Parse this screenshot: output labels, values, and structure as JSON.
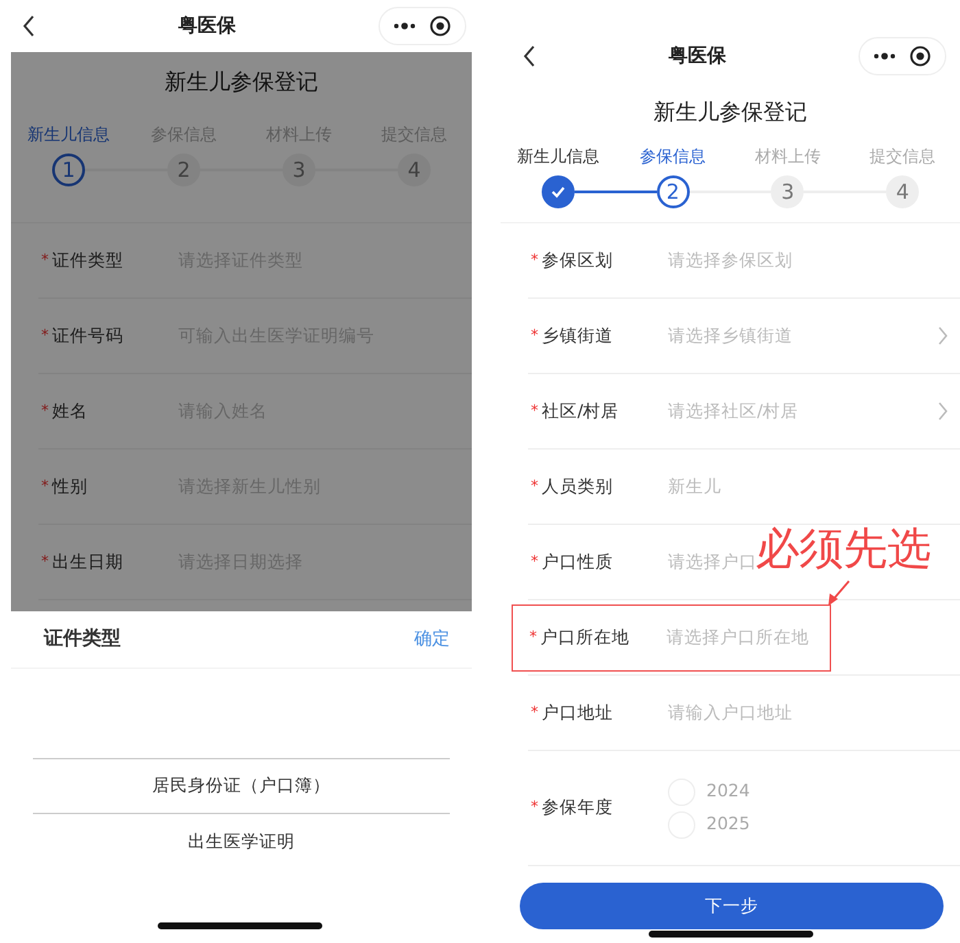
{
  "screens": [
    {
      "nav": {
        "title": "粤医保"
      },
      "page_title": "新生儿参保登记",
      "steps": [
        {
          "label": "新生儿信息",
          "number": "1",
          "completed": false,
          "current": true
        },
        {
          "label": "参保信息",
          "number": "2",
          "completed": false,
          "current": false
        },
        {
          "label": "材料上传",
          "number": "3",
          "completed": false,
          "current": false
        },
        {
          "label": "提交信息",
          "number": "4",
          "completed": false,
          "current": false
        }
      ],
      "fields": [
        {
          "kind": "text",
          "required_mark": "*",
          "label": "证件类型",
          "placeholder": "请选择证件类型"
        },
        {
          "kind": "text",
          "required_mark": "*",
          "label": "证件号码",
          "placeholder": "可输入出生医学证明编号"
        },
        {
          "kind": "text",
          "required_mark": "*",
          "label": "姓名",
          "placeholder": "请输入姓名"
        },
        {
          "kind": "text",
          "required_mark": "*",
          "label": "性别",
          "placeholder": "请选择新生儿性别"
        },
        {
          "kind": "text",
          "required_mark": "*",
          "label": "出生日期",
          "placeholder": "请选择日期选择"
        }
      ],
      "dimmed": true,
      "picker": {
        "title": "证件类型",
        "confirm": "确定",
        "options": [
          {
            "label": "居民身份证（户口簿）",
            "selected": true
          },
          {
            "label": "出生医学证明",
            "selected": false
          }
        ]
      }
    },
    {
      "nav": {
        "title": "粤医保"
      },
      "page_title": "新生儿参保登记",
      "steps": [
        {
          "label": "新生儿信息",
          "completed": true
        },
        {
          "label": "参保信息",
          "number": "2",
          "completed": false,
          "current": true
        },
        {
          "label": "材料上传",
          "number": "3",
          "completed": false,
          "current": false
        },
        {
          "label": "提交信息",
          "number": "4",
          "completed": false,
          "current": false
        }
      ],
      "fields": [
        {
          "kind": "text",
          "required_mark": "*",
          "label": "参保区划",
          "placeholder": "请选择参保区划",
          "chevron": false,
          "highlighted": false
        },
        {
          "kind": "text",
          "required_mark": "*",
          "label": "乡镇街道",
          "placeholder": "请选择乡镇街道",
          "chevron": true,
          "highlighted": false
        },
        {
          "kind": "text",
          "required_mark": "*",
          "label": "社区/村居",
          "placeholder": "请选择社区/村居",
          "chevron": true,
          "highlighted": false
        },
        {
          "kind": "text",
          "required_mark": "*",
          "label": "人员类别",
          "placeholder": "新生儿",
          "chevron": false,
          "highlighted": false
        },
        {
          "kind": "text",
          "required_mark": "*",
          "label": "户口性质",
          "placeholder": "请选择户口",
          "chevron": false,
          "highlighted": false
        },
        {
          "kind": "text",
          "required_mark": "*",
          "label": "户口所在地",
          "placeholder": "请选择户口所在地",
          "chevron": false,
          "highlighted": true
        },
        {
          "kind": "text",
          "required_mark": "*",
          "label": "户口地址",
          "placeholder": "请输入户口地址",
          "chevron": false,
          "highlighted": false
        },
        {
          "kind": "radio",
          "required_mark": "*",
          "label": "参保年度",
          "options": [
            {
              "label": "2024",
              "checked": false
            },
            {
              "label": "2025",
              "checked": false
            }
          ]
        }
      ],
      "annotation": {
        "text": "必须先选"
      },
      "button": "下一步"
    }
  ]
}
